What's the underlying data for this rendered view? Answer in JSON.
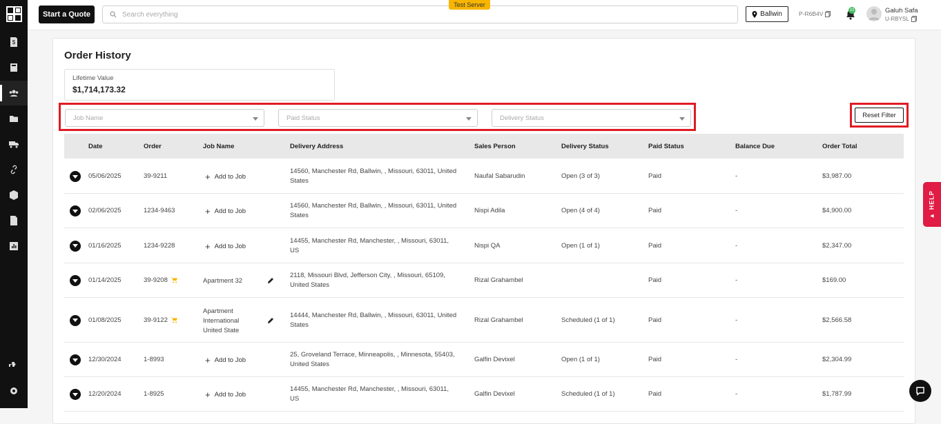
{
  "topbar": {
    "start_quote": "Start a Quote",
    "search_placeholder": "Search everything",
    "test_server": "Test Server",
    "location": "Ballwin",
    "store_code": "P-R6B4V",
    "notification_count": "33",
    "user_name": "Galuh Safa",
    "user_code": "U-RBYSL"
  },
  "page": {
    "title": "Order History",
    "lifetime_label": "Lifetime Value",
    "lifetime_value": "$1,714,173.32",
    "reset_filter": "Reset Filter",
    "help": "HELP"
  },
  "filters": {
    "job_name": "Job Name",
    "paid_status": "Paid Status",
    "delivery_status": "Delivery Status"
  },
  "table": {
    "headers": [
      "Date",
      "Order",
      "Job Name",
      "Delivery Address",
      "Sales Person",
      "Delivery Status",
      "Paid Status",
      "Balance Due",
      "Order Total"
    ],
    "rows": [
      {
        "date": "05/06/2025",
        "order": "39-9211",
        "job": "Add to Job",
        "address": "14560, Manchester Rd, Ballwin, , Missouri, 63011, United States",
        "sales": "Naufal Sabarudin",
        "delivery": "Open (3 of 3)",
        "paid": "Paid",
        "balance": "-",
        "total": "$3,987.00"
      },
      {
        "date": "02/06/2025",
        "order": "1234-9463",
        "job": "Add to Job",
        "address": "14560, Manchester Rd, Ballwin, , Missouri, 63011, United States",
        "sales": "Nispi Adila",
        "delivery": "Open (4 of 4)",
        "paid": "Paid",
        "balance": "-",
        "total": "$4,900.00"
      },
      {
        "date": "01/16/2025",
        "order": "1234-9228",
        "job": "Add to Job",
        "address": "14455, Manchester Rd, Manchester, , Missouri, 63011, US",
        "sales": "Nispi QA",
        "delivery": "Open (1 of 1)",
        "paid": "Paid",
        "balance": "-",
        "total": "$2,347.00"
      },
      {
        "date": "01/14/2025",
        "order": "39-9208",
        "job": "Apartment 32",
        "address": "2118, Missouri Blvd, Jefferson City, , Missouri, 65109, United States",
        "sales": "Rizal Grahambel",
        "delivery": "",
        "paid": "Paid",
        "balance": "-",
        "total": "$169.00"
      },
      {
        "date": "01/08/2025",
        "order": "39-9122",
        "job": "Apartment International United State",
        "address": "14444, Manchester Rd, Ballwin, , Missouri, 63011, United States",
        "sales": "Rizal Grahambel",
        "delivery": "Scheduled (1 of 1)",
        "paid": "Paid",
        "balance": "-",
        "total": "$2,566.58"
      },
      {
        "date": "12/30/2024",
        "order": "1-8993",
        "job": "Add to Job",
        "address": "25, Groveland Terrace, Minneapolis, , Minnesota, 55403, United States",
        "sales": "Galfin Devixel",
        "delivery": "Open (1 of 1)",
        "paid": "Paid",
        "balance": "-",
        "total": "$2,304.99"
      },
      {
        "date": "12/20/2024",
        "order": "1-8925",
        "job": "Add to Job",
        "address": "14455, Manchester Rd, Manchester, , Missouri, 63011, US",
        "sales": "Galfin Devixel",
        "delivery": "Scheduled (1 of 1)",
        "paid": "Paid",
        "balance": "-",
        "total": "$1,787.99"
      }
    ]
  }
}
